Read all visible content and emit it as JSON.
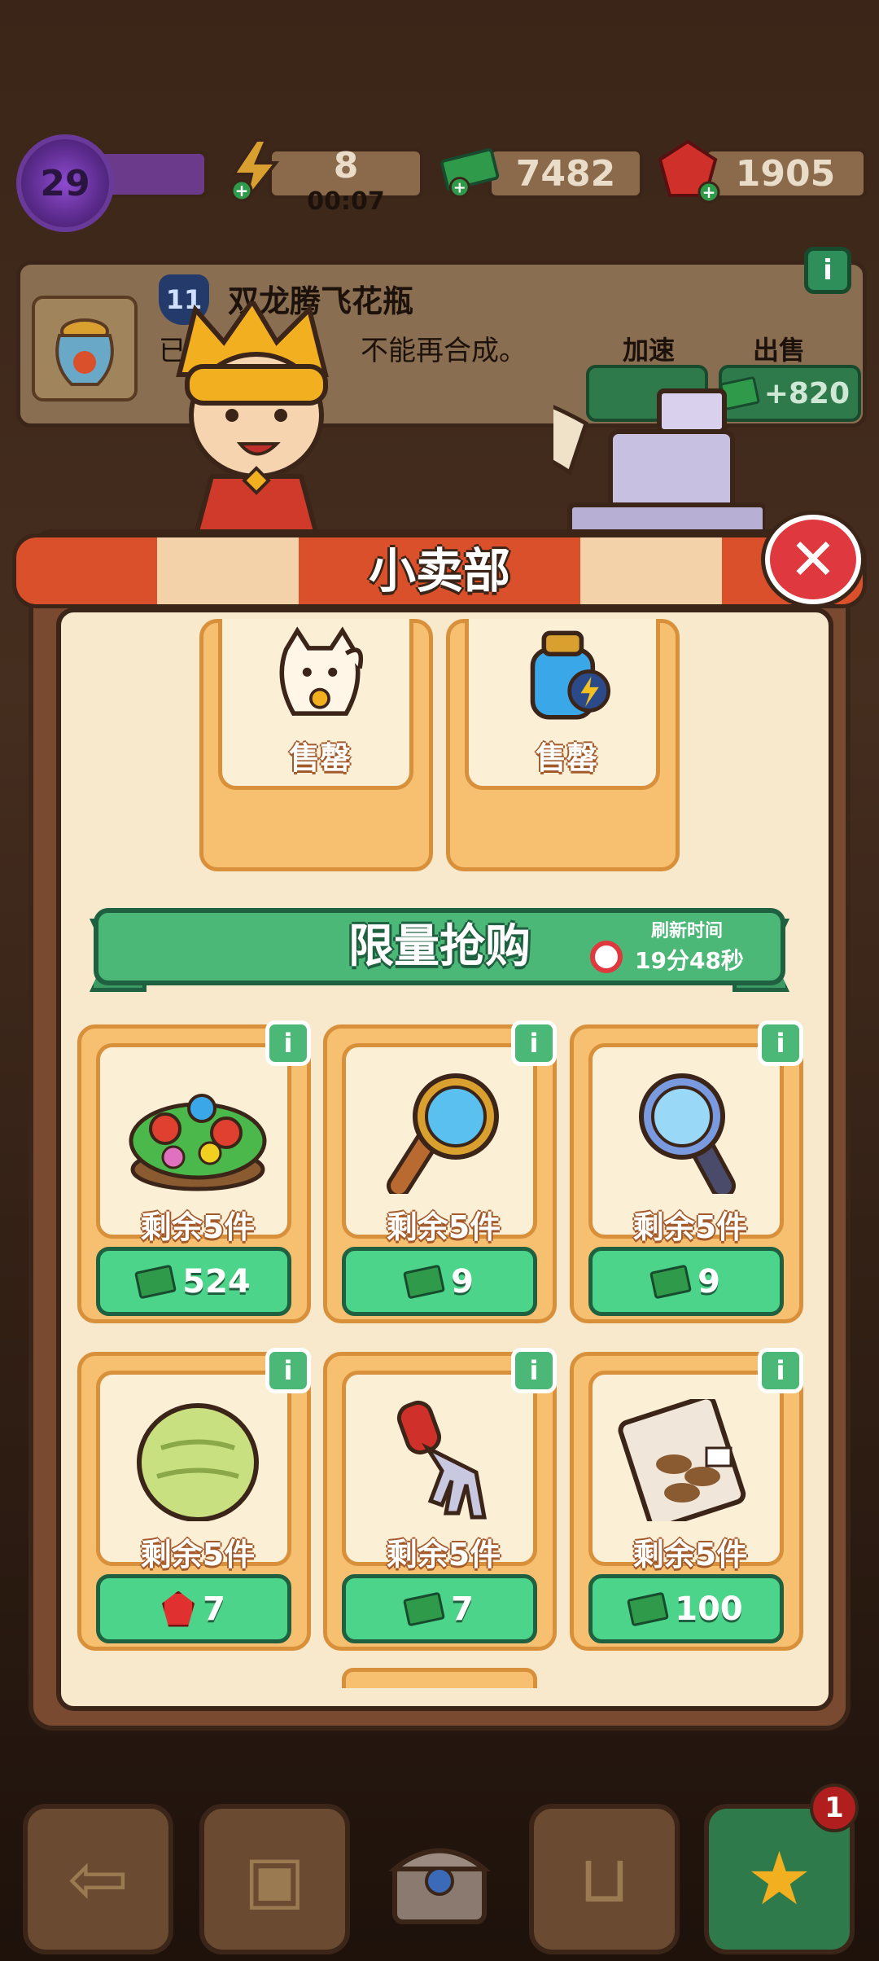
{
  "topbar": {
    "level": "29",
    "energy": "8",
    "energy_timer": "00:07",
    "cash": "7482",
    "gems": "1905"
  },
  "item_info": {
    "level": "11",
    "title": "双龙腾飞花瓶",
    "desc_prefix": "已达",
    "desc_suffix": "不能再合成。",
    "speed_label": "加速",
    "sell_label": "出售",
    "sell_value": "+820"
  },
  "shop": {
    "title": "小卖部",
    "sold_out": [
      {
        "label": "售罄",
        "icon": "lucky-cat-icon"
      },
      {
        "label": "售罄",
        "icon": "energy-jar-icon"
      }
    ],
    "section_title": "限量抢购",
    "refresh_label": "刷新时间",
    "refresh_time": "19分48秒",
    "products": [
      {
        "icon": "flower-bush-icon",
        "stock": "剩余5件",
        "currency": "cash",
        "price": "524"
      },
      {
        "icon": "magnifier-brown-icon",
        "stock": "剩余5件",
        "currency": "cash",
        "price": "9"
      },
      {
        "icon": "magnifier-blue-icon",
        "stock": "剩余5件",
        "currency": "cash",
        "price": "9"
      },
      {
        "icon": "melon-icon",
        "stock": "剩余5件",
        "currency": "gem",
        "price": "7"
      },
      {
        "icon": "garden-fork-icon",
        "stock": "剩余5件",
        "currency": "cash",
        "price": "7"
      },
      {
        "icon": "seed-bag-icon",
        "stock": "剩余5件",
        "currency": "cash",
        "price": "100"
      }
    ]
  },
  "bottom_nav": {
    "notification_count": "1"
  }
}
